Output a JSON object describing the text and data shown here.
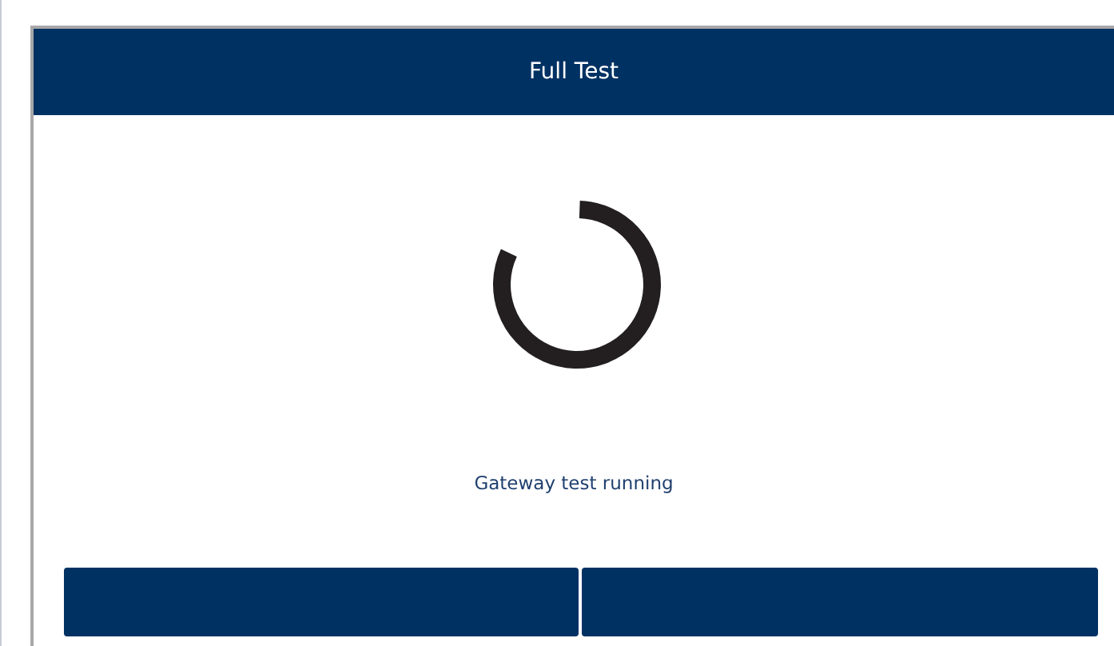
{
  "header": {
    "title": "Full Test"
  },
  "status": {
    "message": "Gateway test running"
  },
  "buttons": [
    {
      "kind": "blank"
    },
    {
      "kind": "blank"
    }
  ]
}
